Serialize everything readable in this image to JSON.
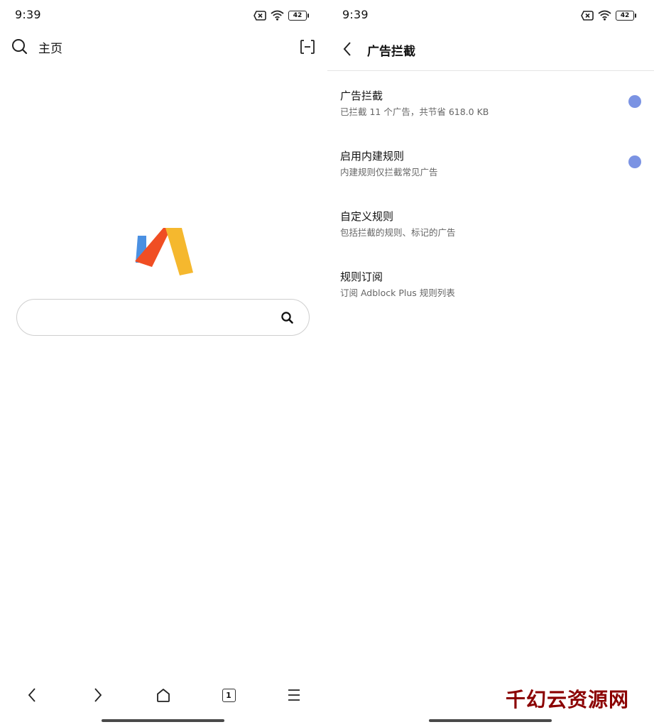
{
  "left": {
    "status": {
      "time": "9:39",
      "battery": "42"
    },
    "header": {
      "title": "主页"
    },
    "bottom_nav": {
      "tab_count": "1"
    }
  },
  "right": {
    "status": {
      "time": "9:39",
      "battery": "42"
    },
    "header": {
      "title": "广告拦截"
    },
    "settings": [
      {
        "title": "广告拦截",
        "subtitle": "已拦截 11 个广告，共节省 618.0 KB",
        "enabled": true
      },
      {
        "title": "启用内建规则",
        "subtitle": "内建规则仅拦截常见广告",
        "enabled": true
      },
      {
        "title": "自定义规则",
        "subtitle": "包括拦截的规则、标记的广告"
      },
      {
        "title": "规则订阅",
        "subtitle": "订阅 Adblock Plus 规则列表"
      }
    ],
    "watermark": "千幻云资源网"
  },
  "colors": {
    "toggle_on": "#7b93e3",
    "watermark": "#8b0000"
  }
}
